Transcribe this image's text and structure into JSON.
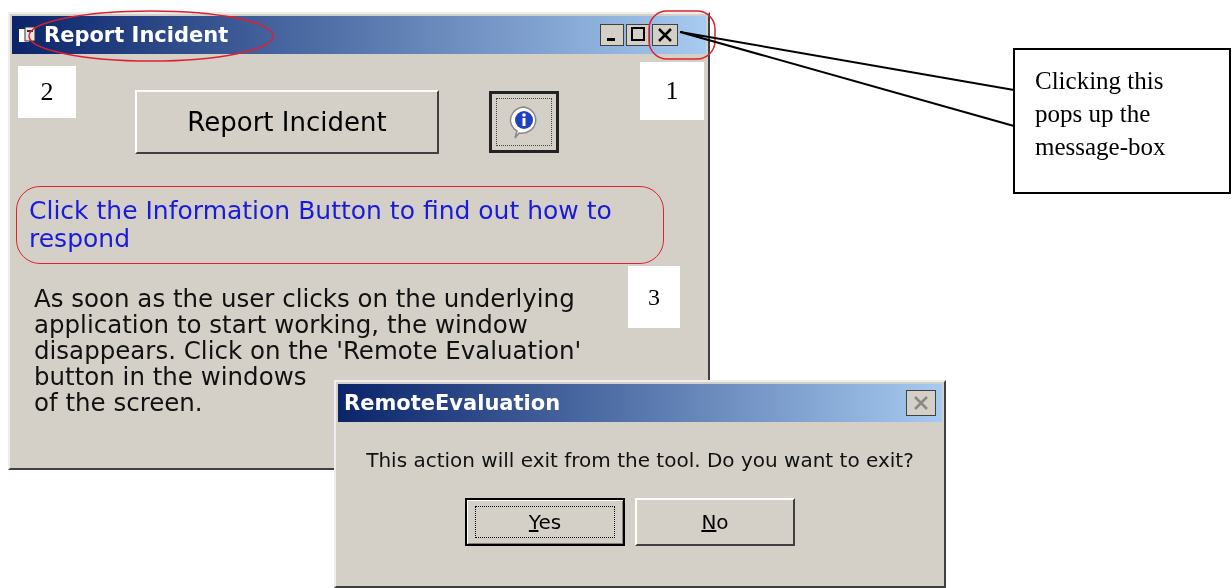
{
  "main_window": {
    "title": "Report Incident",
    "report_button": "Report Incident",
    "hint": "Click the Information Button to find out how to respond",
    "description_lines": [
      "As soon as the user clicks on the underlying",
      "application to start working, the window",
      "disappears. Click on the 'Remote Evaluation'",
      "button in the windows",
      "of the screen."
    ]
  },
  "dialog": {
    "title": "RemoteEvaluation",
    "message": "This action will exit from the tool. Do you want to exit?",
    "buttons": [
      {
        "label": "Yes",
        "focused": true
      },
      {
        "label": "No",
        "focused": false
      }
    ]
  },
  "annotations": {
    "markers": [
      "2",
      "1",
      "3"
    ],
    "callout": "Clicking this pops up the message-box"
  }
}
